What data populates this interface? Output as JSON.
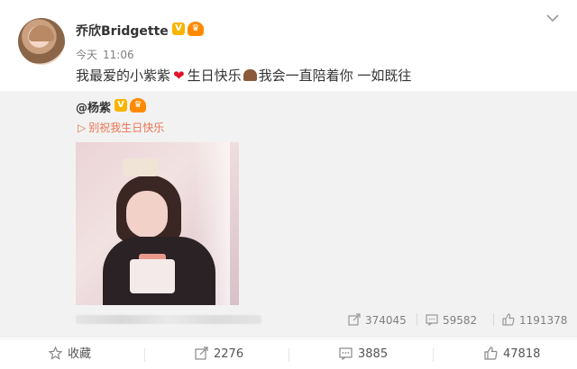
{
  "author": {
    "name": "乔欣Bridgette",
    "badge_v": "V",
    "timestamp_day": "今天",
    "timestamp_time": "11:06"
  },
  "post": {
    "text_1": "我最爱的小紫紫",
    "text_2": "生日快乐",
    "text_3": "我会一直陪着你 一如既往"
  },
  "repost": {
    "user": "@杨紫",
    "badge_v": "V",
    "link_text": "别祝我生日快乐",
    "stats": {
      "shares": "374045",
      "comments": "59582",
      "likes": "1191378"
    }
  },
  "actions": {
    "favorite_label": "收藏",
    "shares": "2276",
    "comments": "3885",
    "likes": "47818"
  },
  "colors": {
    "link": "#eb7350",
    "badge_gold": "#f7b500",
    "badge_orange": "#ff8a00",
    "heart": "#e0142c"
  }
}
